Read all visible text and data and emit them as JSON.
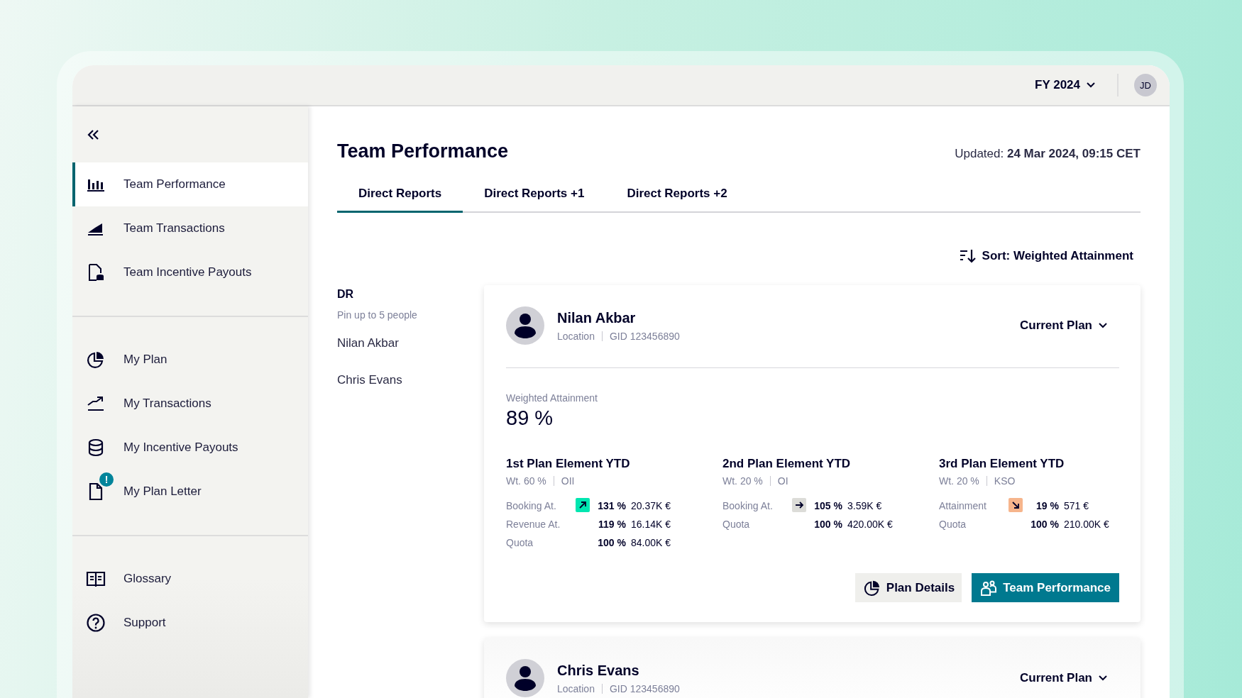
{
  "header": {
    "fiscal_year": "FY 2024",
    "avatar": "JD"
  },
  "sidebar": {
    "groups": [
      [
        {
          "label": "Team Performance",
          "selected": true
        },
        {
          "label": "Team Transactions",
          "selected": false
        },
        {
          "label": "Team Incentive Payouts",
          "selected": false
        }
      ],
      [
        {
          "label": "My Plan",
          "selected": false
        },
        {
          "label": "My Transactions",
          "selected": false
        },
        {
          "label": "My Incentive Payouts",
          "selected": false
        },
        {
          "label": "My Plan Letter",
          "selected": false,
          "badge": "!"
        }
      ],
      [
        {
          "label": "Glossary",
          "selected": false
        },
        {
          "label": "Support",
          "selected": false
        }
      ]
    ]
  },
  "page": {
    "title": "Team Performance",
    "updated": "Updated: **24 Mar 2024, 09:15 CET**"
  },
  "tabs": [
    {
      "label": "Direct Reports",
      "selected": true
    },
    {
      "label": "Direct Reports +1",
      "selected": false
    },
    {
      "label": "Direct Reports +2",
      "selected": false
    }
  ],
  "sort": {
    "label": "Sort: Weighted Attainment"
  },
  "pins": {
    "heading": "DR",
    "hint": "Pin up to 5 people",
    "people": [
      "Nilan Akbar",
      "Chris Evans"
    ]
  },
  "cards": [
    {
      "name": "Nilan Akbar",
      "location": "Location",
      "gid": "GID 123456890",
      "plan_menu": "Current Plan",
      "weighted_label": "Weighted Attainment",
      "weighted_value": "89 %",
      "elements": [
        {
          "title": "1st Plan Element YTD",
          "weight": "Wt. 60 %",
          "type": "OII",
          "rows": [
            {
              "label": "Booking At.",
              "kind": "up",
              "percent": "131 %",
              "amount": "20.37K €"
            },
            {
              "label": "Revenue At.",
              "kind": "plain",
              "percent": "119 %",
              "amount": "16.14K €"
            },
            {
              "label": "Quota",
              "kind": "plain",
              "percent": "100 %",
              "amount": "84.00K €"
            }
          ]
        },
        {
          "title": "2nd Plan Element YTD",
          "weight": "Wt. 20 %",
          "type": "OI",
          "rows": [
            {
              "label": "Booking At.",
              "kind": "flat",
              "percent": "105 %",
              "amount": "3.59K €"
            },
            {
              "label": "Quota",
              "kind": "plain",
              "percent": "100 %",
              "amount": "420.00K €"
            }
          ]
        },
        {
          "title": "3rd Plan Element YTD",
          "weight": "Wt. 20 %",
          "type": "KSO",
          "rows": [
            {
              "label": "Attainment",
              "kind": "down",
              "percent": "19 %",
              "amount": "571 €"
            },
            {
              "label": "Quota",
              "kind": "plain",
              "percent": "100 %",
              "amount": "210.00K €"
            }
          ]
        }
      ],
      "buttons": [
        {
          "label": "Plan Details",
          "kind": "secondary"
        },
        {
          "label": "Team Performance",
          "kind": "primary"
        }
      ]
    },
    {
      "name": "Chris Evans",
      "location": "Location",
      "gid": "GID 123456890",
      "plan_menu": "Current Plan"
    }
  ]
}
